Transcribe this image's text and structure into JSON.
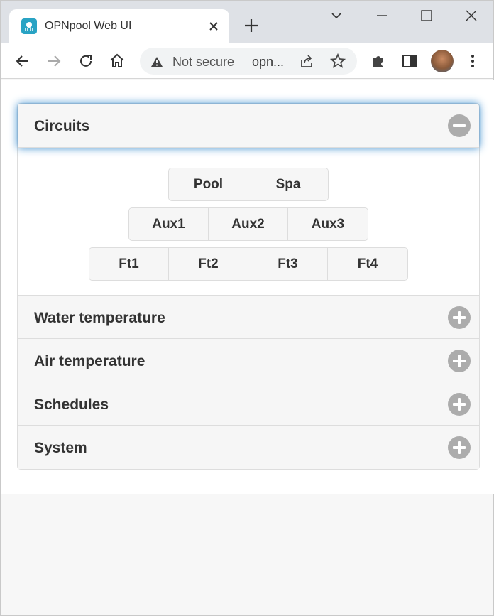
{
  "browser": {
    "tab_title": "OPNpool Web UI",
    "security_label": "Not secure",
    "url": "opn..."
  },
  "accordion": {
    "sections": [
      {
        "title": "Circuits",
        "expanded": true
      },
      {
        "title": "Water temperature",
        "expanded": false
      },
      {
        "title": "Air temperature",
        "expanded": false
      },
      {
        "title": "Schedules",
        "expanded": false
      },
      {
        "title": "System",
        "expanded": false
      }
    ]
  },
  "circuits": {
    "row1": [
      "Pool",
      "Spa"
    ],
    "row2": [
      "Aux1",
      "Aux2",
      "Aux3"
    ],
    "row3": [
      "Ft1",
      "Ft2",
      "Ft3",
      "Ft4"
    ]
  },
  "icons": {
    "collapse": "minus-circle-icon",
    "expand": "plus-circle-icon"
  },
  "colors": {
    "active_glow": "#3388cc",
    "header_bg": "#f6f6f6",
    "icon_gray": "#acacac",
    "favicon": "#29a3c4"
  }
}
